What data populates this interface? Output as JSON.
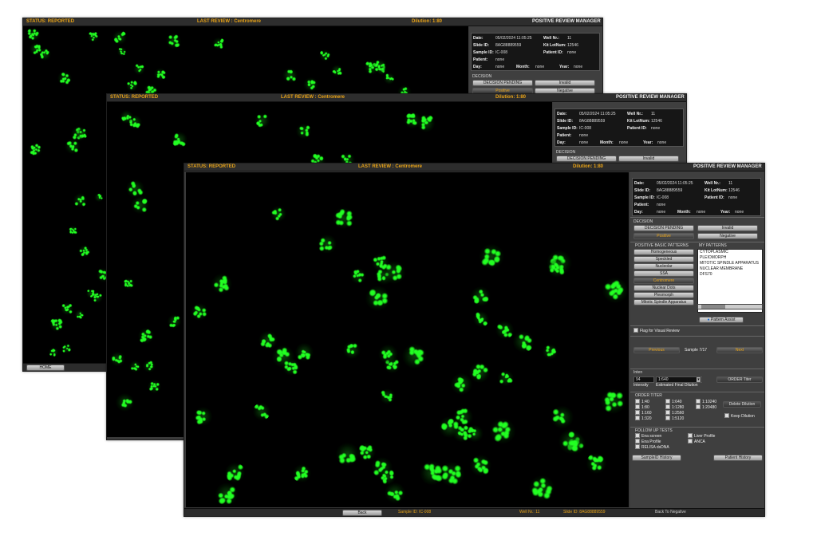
{
  "status": "STATUS: REPORTED",
  "last_review": "LAST REVIEW : Centromere",
  "dilution": "Dilution: 1:80",
  "manager_title": "POSITIVE REVIEW MANAGER",
  "info": {
    "date_label": "Date:",
    "date_value": "05/02/2024 11:05:25",
    "well_label": "Well Nr.:",
    "well_value": "11",
    "slide_label": "Slide ID:",
    "slide_value": "8AG88889559",
    "kit_label": "Kit LotNum:",
    "kit_value": "12546",
    "sample_label": "Sample ID:",
    "sample_value": "IC-008",
    "patient_id_label": "Patient ID:",
    "patient_id_value": "none",
    "patient_label": "Patient:",
    "patient_value": "none",
    "day_label": "Day:",
    "day_value": "none",
    "month_label": "Month:",
    "month_value": "none",
    "year_label": "Year:",
    "year_value": "none"
  },
  "decision": {
    "title": "DECISION",
    "pending": "DECISION PENDING",
    "invalid": "Invalid",
    "positive": "Positive",
    "negative": "Negative"
  },
  "patterns": {
    "basic_title": "POSITIVE BASIC PATTERNS",
    "my_title": "MY PATTERNS",
    "basic": [
      "Homogeneous",
      "Speckled",
      "Nucleolar",
      "SSA",
      "Centromere",
      "Nuclear Dots",
      "Pleomorph",
      "Mitotic Spindle Apparatus"
    ],
    "my": [
      "CYTOPLASMIC",
      "PLEIOMORPH",
      "MITOTIC SPINDLE APPARATUS",
      "NUCLEAR MEMBRANE",
      "DFS70"
    ],
    "assist": "Pattern Assist"
  },
  "flag": "Flag for Visual Review",
  "nav": {
    "previous": "Previous",
    "sample_count": "Sample 7/17",
    "next": "Next"
  },
  "intensity": {
    "section": "Inten",
    "value": "94",
    "label": "Intensity",
    "dilution_value": "1:640",
    "dilution_label": "Estimated Final Dilution",
    "order_titer": "ORDER Titer"
  },
  "order_titer": {
    "title": "ORDER TITER",
    "items": [
      "1:40",
      "1:80",
      "1:160",
      "1:320",
      "1:640",
      "1:1280",
      "1:2560",
      "1:5120",
      "1:10240",
      "1:20480"
    ],
    "delete": "Delete Dilution",
    "keep": "Keep Dilution"
  },
  "follow_up": {
    "title": "FOLLOW UP TESTS",
    "items": [
      "Ena screen",
      "Ena Profile",
      "RELISA dsDNA",
      "Liver Profile",
      "ANCA"
    ]
  },
  "sample_history": "SampleID History",
  "patient_history": "Patient History",
  "bottom": {
    "back": "Back",
    "sample": "Sample ID: IC-008",
    "well": "Well Nr.: 11",
    "slide": "Slide ID: 8AG88889559",
    "back_negative": "Back To Negative",
    "home": "HOME"
  },
  "colors": {
    "accent": "#e8a317",
    "fluorescence": "#22ff22",
    "panel": "#3a3a3a"
  }
}
